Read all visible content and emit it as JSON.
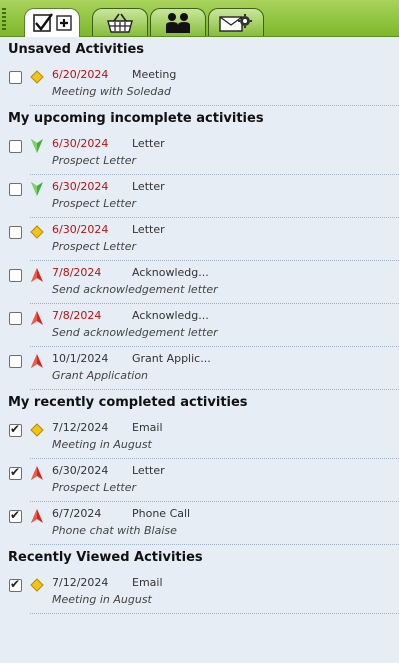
{
  "tabs": [
    {
      "name": "activities",
      "icon": "checkmark-plus-icon",
      "active": true
    },
    {
      "name": "basket",
      "icon": "basket-icon",
      "active": false
    },
    {
      "name": "people",
      "icon": "people-icon",
      "active": false
    },
    {
      "name": "mail",
      "icon": "envelope-gear-icon",
      "active": false
    }
  ],
  "sections": [
    {
      "title": "Unsaved Activities",
      "items": [
        {
          "checked": false,
          "priority": "medium",
          "date": "6/20/2024",
          "overdue": true,
          "type": "Meeting",
          "desc": "Meeting with Soledad"
        }
      ]
    },
    {
      "title": "My upcoming incomplete activities",
      "items": [
        {
          "checked": false,
          "priority": "low",
          "date": "6/30/2024",
          "overdue": true,
          "type": "Letter",
          "desc": "Prospect Letter"
        },
        {
          "checked": false,
          "priority": "low",
          "date": "6/30/2024",
          "overdue": true,
          "type": "Letter",
          "desc": "Prospect Letter"
        },
        {
          "checked": false,
          "priority": "medium",
          "date": "6/30/2024",
          "overdue": true,
          "type": "Letter",
          "desc": "Prospect Letter"
        },
        {
          "checked": false,
          "priority": "high",
          "date": "7/8/2024",
          "overdue": true,
          "type": "Acknowledg...",
          "desc": "Send acknowledgement letter"
        },
        {
          "checked": false,
          "priority": "high",
          "date": "7/8/2024",
          "overdue": true,
          "type": "Acknowledg...",
          "desc": "Send acknowledgement letter"
        },
        {
          "checked": false,
          "priority": "high",
          "date": "10/1/2024",
          "overdue": false,
          "type": "Grant Applic...",
          "desc": "Grant Application"
        }
      ]
    },
    {
      "title": "My recently completed activities",
      "items": [
        {
          "checked": true,
          "priority": "medium",
          "date": "7/12/2024",
          "overdue": false,
          "type": "Email",
          "desc": "Meeting in August"
        },
        {
          "checked": true,
          "priority": "high",
          "date": "6/30/2024",
          "overdue": false,
          "type": "Letter",
          "desc": "Prospect Letter"
        },
        {
          "checked": true,
          "priority": "high",
          "date": "6/7/2024",
          "overdue": false,
          "type": "Phone Call",
          "desc": "Phone chat with Blaise"
        }
      ]
    },
    {
      "title": "Recently Viewed Activities",
      "items": [
        {
          "checked": true,
          "priority": "medium",
          "date": "7/12/2024",
          "overdue": false,
          "type": "Email",
          "desc": "Meeting in August"
        }
      ]
    }
  ],
  "colors": {
    "overdue_date": "#b31515",
    "tabbar_green": "#8cc63f",
    "background": "#e6edf4"
  }
}
